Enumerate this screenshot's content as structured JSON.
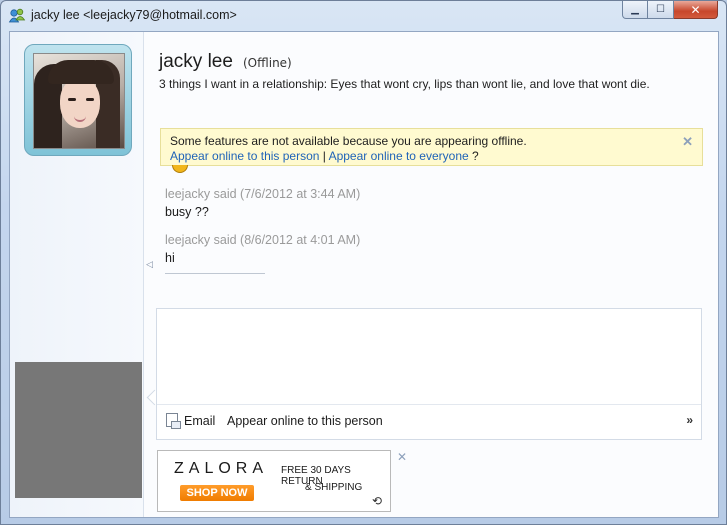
{
  "window": {
    "title": "jacky lee <leejacky79@hotmail.com>",
    "controls": {
      "minimize": "▁",
      "maximize": "☐",
      "close": "✕"
    }
  },
  "contact": {
    "name": "jacky lee",
    "status": "(Offline)",
    "personal_message": "3 things I want in a relationship: Eyes that wont cry, lips than wont lie, and love that wont die."
  },
  "infobar": {
    "message": "Some features are not available because you are appearing offline.",
    "link_person": "Appear online to this person",
    "separator": "|",
    "link_everyone": "Appear online to everyone",
    "question": "?",
    "close": "✕"
  },
  "conversation": [
    {
      "said": "leejacky said (7/6/2012 at 3:44 AM)",
      "text": "busy ??"
    },
    {
      "said": "leejacky said (8/6/2012 at 4:01 AM)",
      "text": "hi"
    }
  ],
  "compose": {
    "email_label": "Email",
    "appear_online_label": "Appear online to this person",
    "more_label": "»"
  },
  "ad": {
    "brand": "ZALORA",
    "cta": "SHOP NOW",
    "promo_line1": "FREE 30 DAYS RETURN",
    "promo_line2": "& SHIPPING",
    "replay": "⟲",
    "close": "✕"
  },
  "left_panel": {
    "collapse_arrow": "◁"
  },
  "colors": {
    "link": "#1f63b8",
    "infobar_bg": "#fffad0",
    "said_text": "#9a9a9a",
    "ad_cta": "#f07c00",
    "close_button": "#c7472c"
  }
}
